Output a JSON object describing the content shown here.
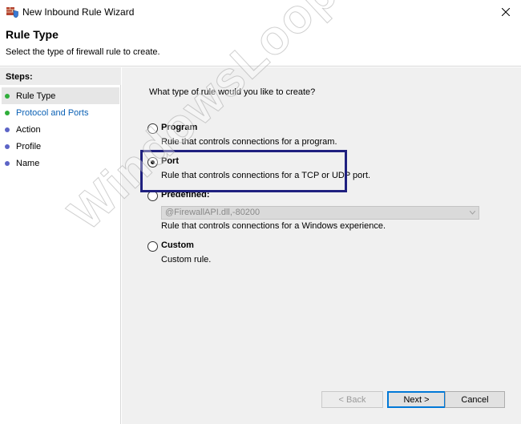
{
  "window": {
    "title": "New Inbound Rule Wizard",
    "app_icon": "firewall-shield-icon",
    "close_icon": "close-icon"
  },
  "header": {
    "title": "Rule Type",
    "subtitle": "Select the type of firewall rule to create."
  },
  "steps": {
    "heading": "Steps:",
    "items": [
      {
        "label": "Rule Type",
        "dot": "green",
        "active": true
      },
      {
        "label": "Protocol and Ports",
        "dot": "green",
        "link": true
      },
      {
        "label": "Action",
        "dot": "blue"
      },
      {
        "label": "Profile",
        "dot": "blue"
      },
      {
        "label": "Name",
        "dot": "blue"
      }
    ]
  },
  "main": {
    "question": "What type of rule would you like to create?",
    "options": [
      {
        "title": "Program",
        "description": "Rule that controls connections for a program.",
        "selected": false
      },
      {
        "title": "Port",
        "description": "Rule that controls connections for a TCP or UDP port.",
        "selected": true
      },
      {
        "title": "Predefined:",
        "description": "Rule that controls connections for a Windows experience.",
        "selected": false,
        "select_value": "@FirewallAPI.dll,-80200"
      },
      {
        "title": "Custom",
        "description": "Custom rule.",
        "selected": false
      }
    ]
  },
  "buttons": {
    "back": "< Back",
    "next": "Next >",
    "cancel": "Cancel"
  },
  "watermark": "WindowsLoop.com",
  "colors": {
    "highlight_border": "#1f207f",
    "step_green": "#2fae3a",
    "step_blue": "#5c64c6",
    "link": "#0b61b5"
  }
}
